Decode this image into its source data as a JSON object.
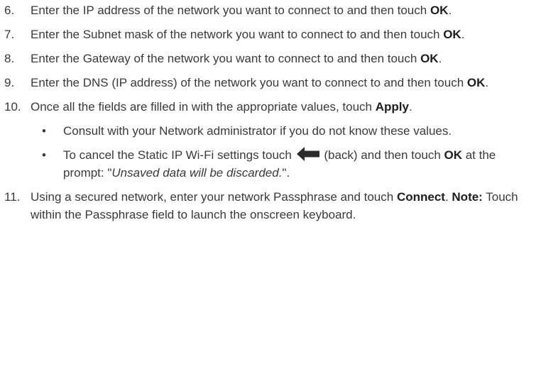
{
  "steps": [
    {
      "num": "6.",
      "pre": "Enter the IP address of the network you want to connect to and then touch ",
      "bold": "OK",
      "post": "."
    },
    {
      "num": "7.",
      "pre": "Enter the Subnet mask of the network you want to connect to and then touch ",
      "bold": "OK",
      "post": "."
    },
    {
      "num": "8.",
      "pre": "Enter the Gateway of the network you want to connect to and then touch ",
      "bold": "OK",
      "post": "."
    },
    {
      "num": "9.",
      "pre": "Enter the DNS (IP address) of the network you want to connect to and then touch ",
      "bold": "OK",
      "post": "."
    },
    {
      "num": "10.",
      "pre": "Once all the fields are filled in with the appropriate values, touch ",
      "bold": "Apply",
      "post": "."
    },
    {
      "num": "11.",
      "pre": "Using a secured network, enter your network Passphrase and touch ",
      "bold": "Connect",
      "mid": ". ",
      "bold2": "Note:",
      "post": " Touch within the Passphrase field to launch the onscreen keyboard."
    }
  ],
  "substeps": [
    {
      "bullet": "•",
      "text": "Consult with your Network administrator if you do not know these values."
    },
    {
      "bullet": "•",
      "pre": "To cancel the Static IP Wi-Fi settings touch ",
      "icon": "back-arrow-icon",
      "mid": " (back) and then touch ",
      "bold": "OK",
      "mid2": " at the prompt: \"",
      "italic": "Unsaved data will be discarded.",
      "post": "\"."
    }
  ]
}
